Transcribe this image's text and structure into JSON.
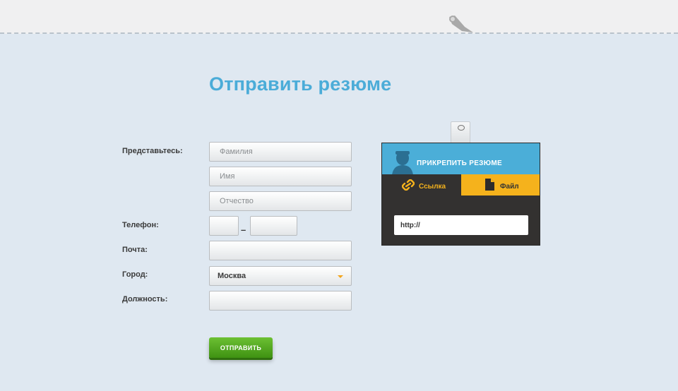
{
  "page": {
    "title": "Отправить резюме"
  },
  "form": {
    "labels": {
      "intro": "Представьтесь:",
      "phone": "Телефон:",
      "email": "Почта:",
      "city": "Город:",
      "position": "Должность:"
    },
    "placeholders": {
      "last_name": "Фамилия",
      "first_name": "Имя",
      "patronymic": "Отчество"
    },
    "phone_separator": "–",
    "city_value": "Москва",
    "submit_label": "ОТПРАВИТЬ"
  },
  "attach": {
    "title": "ПРИКРЕПИТЬ РЕЗЮМЕ",
    "tabs": [
      {
        "label": "Ссылка",
        "icon": "link-icon",
        "active": true
      },
      {
        "label": "Файл",
        "icon": "file-icon",
        "active": false
      }
    ],
    "url_value": "http://"
  },
  "colors": {
    "title_blue": "#4bacd8",
    "accent_orange": "#f5b21c",
    "button_green": "#4fa61e",
    "panel_dark": "#333130",
    "background": "#dfe8f1"
  }
}
